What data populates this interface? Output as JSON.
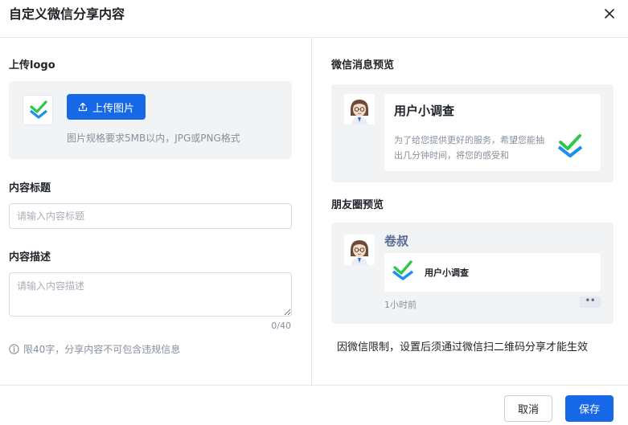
{
  "dialog": {
    "title": "自定义微信分享内容"
  },
  "form": {
    "logo_label": "上传logo",
    "upload_button_label": "上传图片",
    "upload_hint": "图片规格要求5MB以内，JPG或PNG格式",
    "title_label": "内容标题",
    "title_placeholder": "请输入内容标题",
    "title_value": "",
    "desc_label": "内容描述",
    "desc_placeholder": "请输入内容描述",
    "desc_value": "",
    "desc_counter": "0/40",
    "limit_hint": "限40字，分享内容不可包含违规信息"
  },
  "preview": {
    "wechat_label": "微信消息预览",
    "message_title": "用户小调查",
    "message_desc": "为了给您提供更好的服务，希望您能抽出几分钟时间，将您的感受和",
    "moments_label": "朋友圈预览",
    "moments_user": "卷叔",
    "moments_card_title": "用户小调查",
    "moments_time": "1小时前",
    "moments_more": "••",
    "notice": "因微信限制，设置后须通过微信扫二维码分享才能生效"
  },
  "footer": {
    "cancel_label": "取消",
    "save_label": "保存"
  },
  "colors": {
    "accent": "#1768e6",
    "logo_green": "#2bc84d",
    "logo_blue": "#1f8ef1",
    "moments_name": "#576b95"
  },
  "icons": {
    "close": "close-icon",
    "upload": "upload-icon",
    "info": "info-circle-icon",
    "logo": "check-logo-icon",
    "avatar": "avatar-icon"
  }
}
